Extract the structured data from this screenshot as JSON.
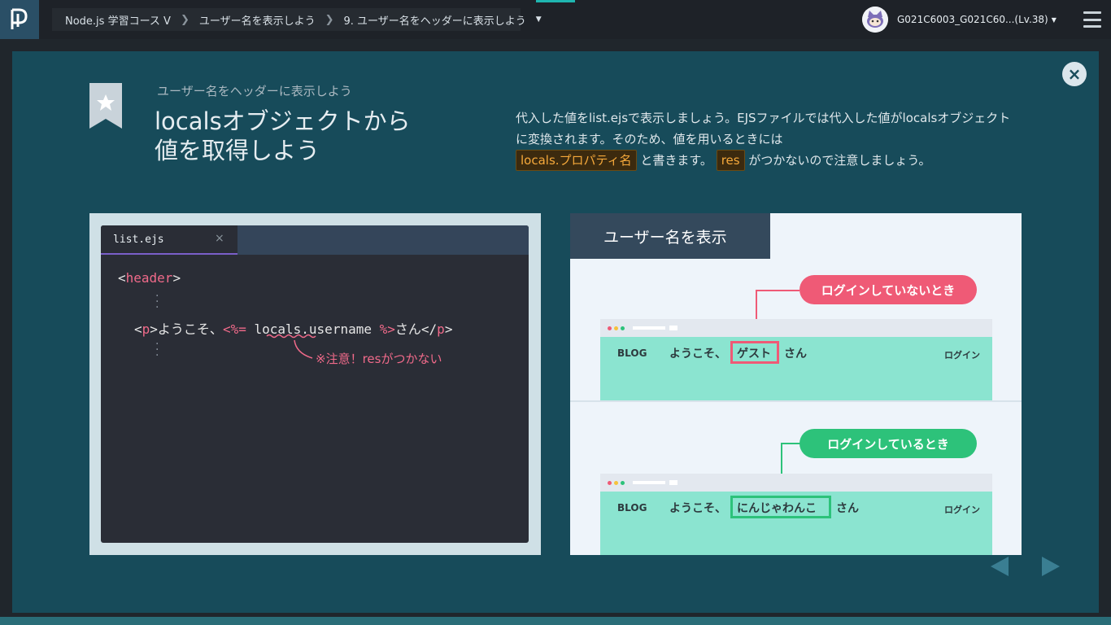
{
  "breadcrumb": {
    "course": "Node.js 学習コース V",
    "section": "ユーザー名を表示しよう",
    "page": "9. ユーザー名をヘッダーに表示しよう"
  },
  "user": {
    "name": "G021C6003_G021C60...(Lv.38)"
  },
  "slide": {
    "subtitle": "ユーザー名をヘッダーに表示しよう",
    "title_line1": "localsオブジェクトから",
    "title_line2": "値を取得しよう",
    "desc_part1": "代入した値をlist.ejsで表示しましょう。EJSファイルでは代入した値がlocalsオブジェクトに変換されます。そのため、値を用いるときには",
    "desc_code1": "locals.プロパティ名",
    "desc_part2": "と書きます。",
    "desc_code2": "res",
    "desc_part3": "がつかないので注意しましょう。"
  },
  "editor": {
    "filename": "list.ejs",
    "close_glyph": "×",
    "header_open": "<",
    "header_tag": "header",
    "header_close": ">",
    "p_open": "<",
    "p_tag": "p",
    "p_close": ">",
    "welcome": "ようこそ、",
    "ejs_open": "<%=",
    "expr": "locals.username",
    "ejs_close": "%>",
    "san": "さん</",
    "p_tag_end": "p",
    "p_end_close": ">",
    "warning": "※注意！resがつかない"
  },
  "preview": {
    "title": "ユーザー名を表示",
    "logged_out_label": "ログインしていないとき",
    "logged_in_label": "ログインしているとき",
    "blog": "BLOG",
    "welcome": "ようこそ、",
    "guest": "ゲスト",
    "user_name": "にんじゃわんこ",
    "san": "さん",
    "login": "ログイン"
  },
  "colors": {
    "modal_bg": "#174b5a",
    "accent_orange": "#f6a93b",
    "pink": "#ef5a76",
    "green": "#2dc27a",
    "mint": "#8be4d0"
  }
}
